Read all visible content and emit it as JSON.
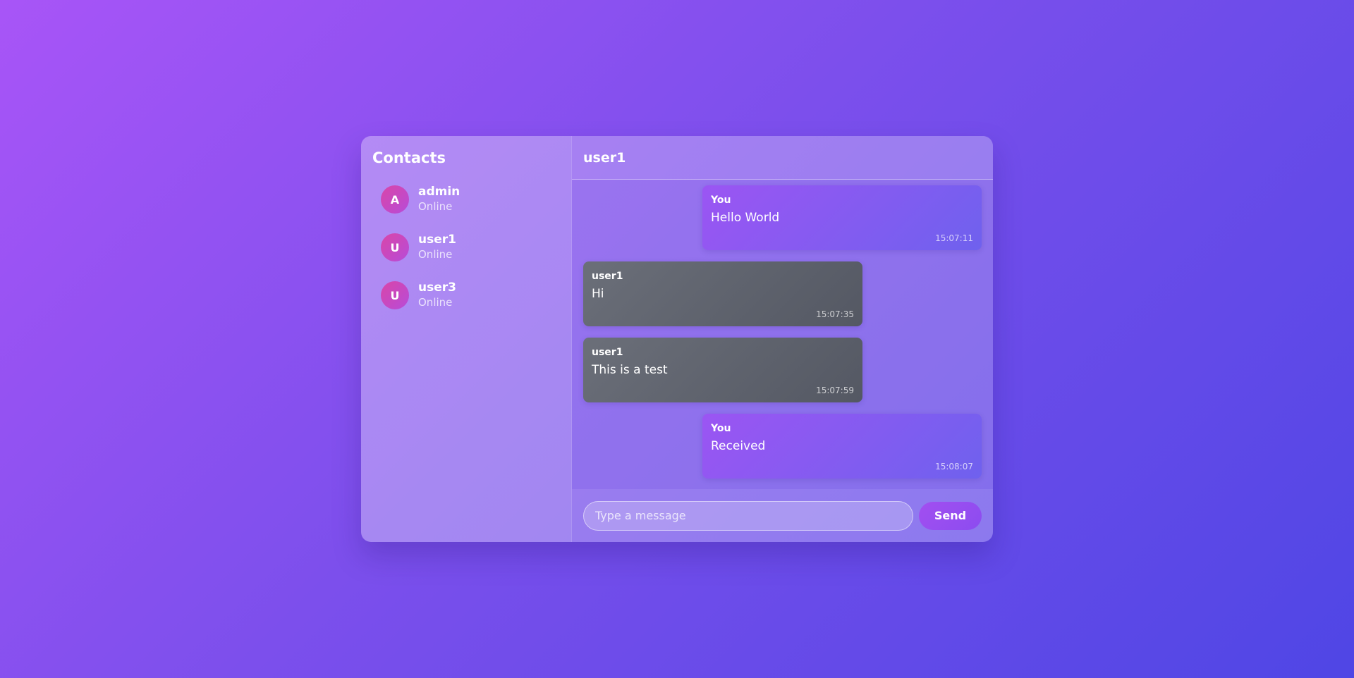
{
  "sidebar": {
    "title": "Contacts",
    "contacts": [
      {
        "initial": "A",
        "name": "admin",
        "status": "Online"
      },
      {
        "initial": "U",
        "name": "user1",
        "status": "Online"
      },
      {
        "initial": "U",
        "name": "user3",
        "status": "Online"
      }
    ]
  },
  "chat": {
    "title": "user1",
    "messages": [
      {
        "sender": "You",
        "text": "Hello World",
        "time": "15:07:11",
        "own": true
      },
      {
        "sender": "user1",
        "text": "Hi",
        "time": "15:07:35",
        "own": false
      },
      {
        "sender": "user1",
        "text": "This is a test",
        "time": "15:07:59",
        "own": false
      },
      {
        "sender": "You",
        "text": "Received",
        "time": "15:08:07",
        "own": true
      }
    ]
  },
  "composer": {
    "placeholder": "Type a message",
    "value": "",
    "send_label": "Send"
  },
  "colors": {
    "background_start": "#a855f7",
    "background_end": "#4f46e5",
    "own_message": "#8b5cf6",
    "other_message": "#5b5f69",
    "avatar": "#d946a8",
    "send_button": "#9b4ff0"
  }
}
